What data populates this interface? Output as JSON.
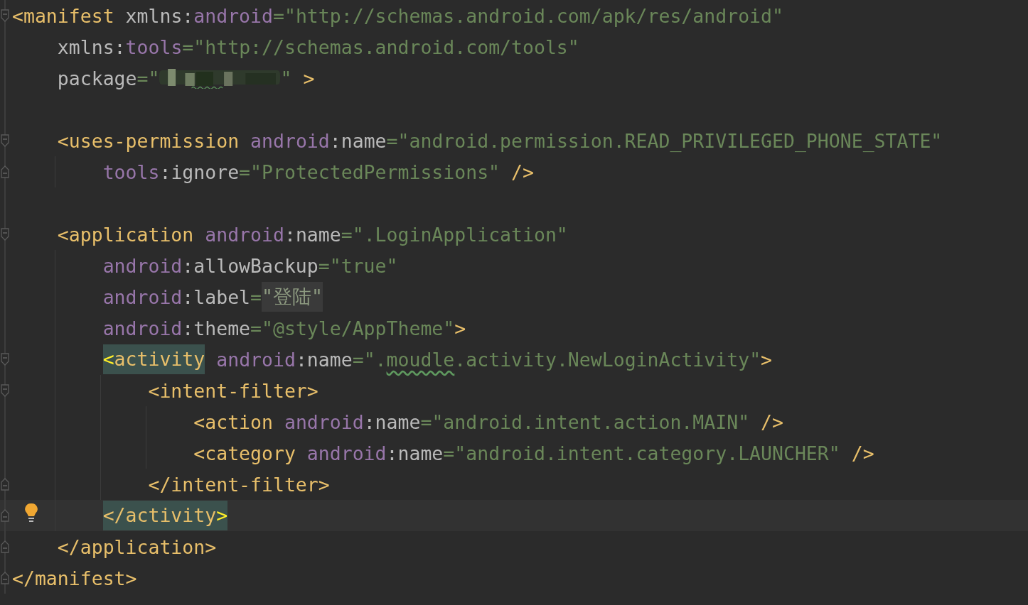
{
  "editor": {
    "lines": [
      {
        "expanded": true,
        "tokens": [
          {
            "kind": "tag",
            "t": "<manifest"
          },
          {
            "kind": "attr",
            "t": " xmlns:"
          },
          {
            "kind": "ns",
            "t": "android"
          },
          {
            "kind": "eq",
            "t": "="
          },
          {
            "kind": "str",
            "t": "\"http://schemas.android.com/apk/res/android\""
          }
        ]
      },
      {
        "tokens": [
          {
            "kind": "attr",
            "t": "    xmlns:"
          },
          {
            "kind": "ns",
            "t": "tools"
          },
          {
            "kind": "eq",
            "t": "="
          },
          {
            "kind": "str",
            "t": "\"http://schemas.android.com/tools\""
          }
        ]
      },
      {
        "tokens": [
          {
            "kind": "attr",
            "t": "    package"
          },
          {
            "kind": "eq",
            "t": "="
          },
          {
            "kind": "str",
            "t": "\""
          },
          {
            "kind": "redacted"
          },
          {
            "kind": "str",
            "t": "\""
          },
          {
            "kind": "tag",
            "t": " >"
          }
        ]
      },
      {
        "blank_line_before": true,
        "expanded": true,
        "tokens": [
          {
            "kind": "tag",
            "t": "    <uses-permission"
          },
          {
            "kind": "ns",
            "t": " android"
          },
          {
            "kind": "attr",
            "t": ":name"
          },
          {
            "kind": "eq",
            "t": "="
          },
          {
            "kind": "str",
            "t": "\"android.permission.READ_PRIVILEGED_PHONE_STATE\""
          }
        ]
      },
      {
        "block_end": true,
        "tokens": [
          {
            "kind": "ns",
            "t": "        tools"
          },
          {
            "kind": "attr",
            "t": ":ignore"
          },
          {
            "kind": "eq",
            "t": "="
          },
          {
            "kind": "str",
            "t": "\"ProtectedPermissions\""
          },
          {
            "kind": "tag",
            "t": " />"
          }
        ]
      },
      {
        "blank_line_before": true,
        "expanded": true,
        "tokens": [
          {
            "kind": "tag",
            "t": "    <application"
          },
          {
            "kind": "ns",
            "t": " android"
          },
          {
            "kind": "attr",
            "t": ":name"
          },
          {
            "kind": "eq",
            "t": "="
          },
          {
            "kind": "str",
            "t": "\".LoginApplication\""
          }
        ]
      },
      {
        "tokens": [
          {
            "kind": "ns",
            "t": "        android"
          },
          {
            "kind": "attr",
            "t": ":allowBackup"
          },
          {
            "kind": "eq",
            "t": "="
          },
          {
            "kind": "str",
            "t": "\"true\""
          }
        ]
      },
      {
        "tokens": [
          {
            "kind": "ns",
            "t": "        android"
          },
          {
            "kind": "attr",
            "t": ":label"
          },
          {
            "kind": "eq",
            "t": "="
          },
          {
            "kind": "folded",
            "t": "\"登陆\""
          }
        ]
      },
      {
        "tokens": [
          {
            "kind": "ns",
            "t": "        android"
          },
          {
            "kind": "attr",
            "t": ":theme"
          },
          {
            "kind": "eq",
            "t": "="
          },
          {
            "kind": "str",
            "t": "\"@style/AppTheme\""
          },
          {
            "kind": "tag",
            "t": ">"
          }
        ]
      },
      {
        "expanded": true,
        "tokens": [
          {
            "kind": "brace",
            "t": "        <",
            "matched": true
          },
          {
            "kind": "tag",
            "t": "activity",
            "matched": true
          },
          {
            "kind": "ns",
            "t": " android"
          },
          {
            "kind": "attr",
            "t": ":name"
          },
          {
            "kind": "eq",
            "t": "="
          },
          {
            "kind": "str",
            "t": "\"."
          },
          {
            "kind": "str",
            "t": "moudle",
            "typo": true
          },
          {
            "kind": "str",
            "t": ".activity.NewLoginActivity\""
          },
          {
            "kind": "tag",
            "t": ">"
          }
        ]
      },
      {
        "expanded": true,
        "tokens": [
          {
            "kind": "tag",
            "t": "            <intent-filter>"
          }
        ]
      },
      {
        "tokens": [
          {
            "kind": "tag",
            "t": "                <action"
          },
          {
            "kind": "ns",
            "t": " android"
          },
          {
            "kind": "attr",
            "t": ":name"
          },
          {
            "kind": "eq",
            "t": "="
          },
          {
            "kind": "str",
            "t": "\"android.intent.action.MAIN\""
          },
          {
            "kind": "tag",
            "t": " />"
          }
        ]
      },
      {
        "tokens": [
          {
            "kind": "tag",
            "t": "                <category"
          },
          {
            "kind": "ns",
            "t": " android"
          },
          {
            "kind": "attr",
            "t": ":name"
          },
          {
            "kind": "eq",
            "t": "="
          },
          {
            "kind": "str",
            "t": "\"android.intent.category.LAUNCHER\""
          },
          {
            "kind": "tag",
            "t": " />"
          }
        ]
      },
      {
        "block_end": true,
        "tokens": [
          {
            "kind": "tag",
            "t": "            </intent-filter>"
          }
        ]
      },
      {
        "block_end": true,
        "current": true,
        "bulb": true,
        "tokens": [
          {
            "kind": "tag",
            "t": "        </activity",
            "matched": true
          },
          {
            "kind": "brace",
            "t": ">",
            "matched": true
          }
        ]
      },
      {
        "block_end": true,
        "tokens": [
          {
            "kind": "tag",
            "t": "    </application>"
          }
        ]
      },
      {
        "block_end": true,
        "tokens": [
          {
            "kind": "tag",
            "t": "</manifest>"
          }
        ]
      }
    ]
  }
}
